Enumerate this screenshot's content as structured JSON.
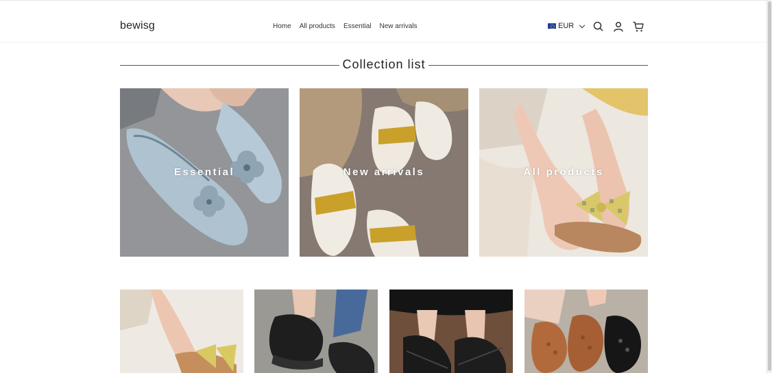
{
  "header": {
    "logo": "bewisg",
    "nav": [
      "Home",
      "All products",
      "Essential",
      "New arrivals"
    ],
    "currency": "EUR"
  },
  "section": {
    "title": "Collection list"
  },
  "collections": [
    {
      "label": "Essential"
    },
    {
      "label": "New arrivals"
    },
    {
      "label": "All products"
    }
  ],
  "colors": {
    "accent": "#1f3fa8"
  }
}
